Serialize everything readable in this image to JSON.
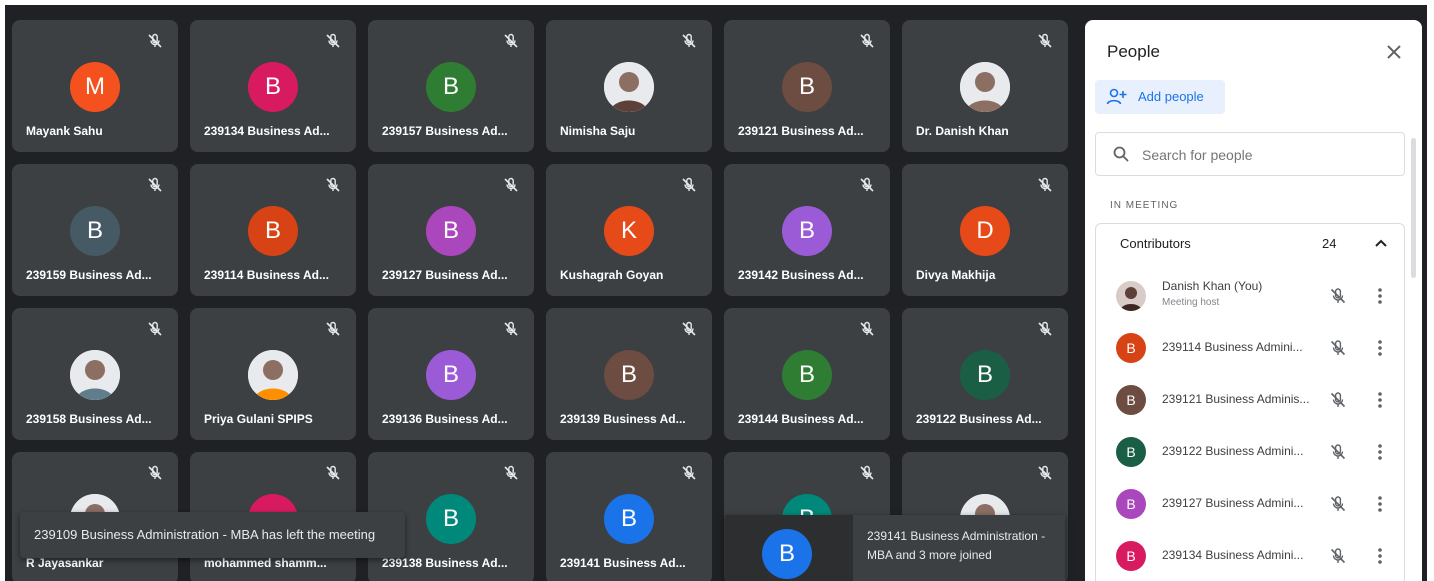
{
  "tiles": [
    {
      "name": "Mayank Sahu",
      "initial": "M",
      "color": "#f4511e",
      "photo": false
    },
    {
      "name": "239134 Business Ad...",
      "initial": "B",
      "color": "#d81b60",
      "photo": false
    },
    {
      "name": "239157 Business Ad...",
      "initial": "B",
      "color": "#2e7d32",
      "photo": false
    },
    {
      "name": "Nimisha Saju",
      "initial": "",
      "color": "#5d4037",
      "photo": true
    },
    {
      "name": "239121 Business Ad...",
      "initial": "B",
      "color": "#6d4c41",
      "photo": false
    },
    {
      "name": "Dr. Danish Khan",
      "initial": "",
      "color": "#8d6e63",
      "photo": true
    },
    {
      "name": "239159 Business Ad...",
      "initial": "B",
      "color": "#455a64",
      "photo": false
    },
    {
      "name": "239114 Business Ad...",
      "initial": "B",
      "color": "#d84315",
      "photo": false
    },
    {
      "name": "239127 Business Ad...",
      "initial": "B",
      "color": "#ab47bc",
      "photo": false
    },
    {
      "name": "Kushagrah Goyan",
      "initial": "K",
      "color": "#e64a19",
      "photo": false
    },
    {
      "name": "239142 Business Ad...",
      "initial": "B",
      "color": "#9c5bd6",
      "photo": false
    },
    {
      "name": "Divya Makhija",
      "initial": "D",
      "color": "#e64a19",
      "photo": false
    },
    {
      "name": "239158 Business Ad...",
      "initial": "",
      "color": "#607d8b",
      "photo": true
    },
    {
      "name": "Priya Gulani SPIPS",
      "initial": "",
      "color": "#ff8f00",
      "photo": true
    },
    {
      "name": "239136 Business Ad...",
      "initial": "B",
      "color": "#9c5bd6",
      "photo": false
    },
    {
      "name": "239139 Business Ad...",
      "initial": "B",
      "color": "#6d4c41",
      "photo": false
    },
    {
      "name": "239144 Business Ad...",
      "initial": "B",
      "color": "#2e7d32",
      "photo": false
    },
    {
      "name": "239122 Business Ad...",
      "initial": "B",
      "color": "#1b5e46",
      "photo": false
    },
    {
      "name": "R Jayasankar",
      "initial": "",
      "color": "#bdbdbd",
      "photo": true
    },
    {
      "name": "mohammed shamm...",
      "initial": "",
      "color": "#d81b60",
      "photo": false
    },
    {
      "name": "239138 Business Ad...",
      "initial": "B",
      "color": "#00897b",
      "photo": false
    },
    {
      "name": "239141 Business Ad...",
      "initial": "B",
      "color": "#1a73e8",
      "photo": false
    },
    {
      "name": "",
      "initial": "B",
      "color": "#00897b",
      "photo": false
    },
    {
      "name": "",
      "initial": "",
      "color": "#4e342e",
      "photo": true
    }
  ],
  "toast": {
    "text": "239109 Business Administration - MBA has left the meeting"
  },
  "joined": {
    "initial": "B",
    "text": "239141 Business Administration - MBA and 3 more joined",
    "color": "#1a73e8"
  },
  "panel": {
    "title": "People",
    "add_label": "Add people",
    "search_placeholder": "Search for people",
    "section_label": "IN MEETING",
    "group_label": "Contributors",
    "group_count": "24",
    "rows": [
      {
        "name": "Danish Khan (You)",
        "sub": "Meeting host",
        "initial": "",
        "color": "#5d4037"
      },
      {
        "name": "239114 Business Admini...",
        "sub": "",
        "initial": "B",
        "color": "#d84315"
      },
      {
        "name": "239121 Business Adminis...",
        "sub": "",
        "initial": "B",
        "color": "#6d4c41"
      },
      {
        "name": "239122 Business Admini...",
        "sub": "",
        "initial": "B",
        "color": "#1b5e46"
      },
      {
        "name": "239127 Business Admini...",
        "sub": "",
        "initial": "B",
        "color": "#ab47bc"
      },
      {
        "name": "239134 Business Admini...",
        "sub": "",
        "initial": "B",
        "color": "#d81b60"
      }
    ]
  },
  "icons": {
    "tile_mic": "mic-off-icon",
    "close": "close-icon",
    "add": "add-person-icon",
    "search": "search-icon",
    "collapse": "chevron-up-icon",
    "row_mic": "mic-off-icon",
    "row_more": "more-vert-icon"
  }
}
